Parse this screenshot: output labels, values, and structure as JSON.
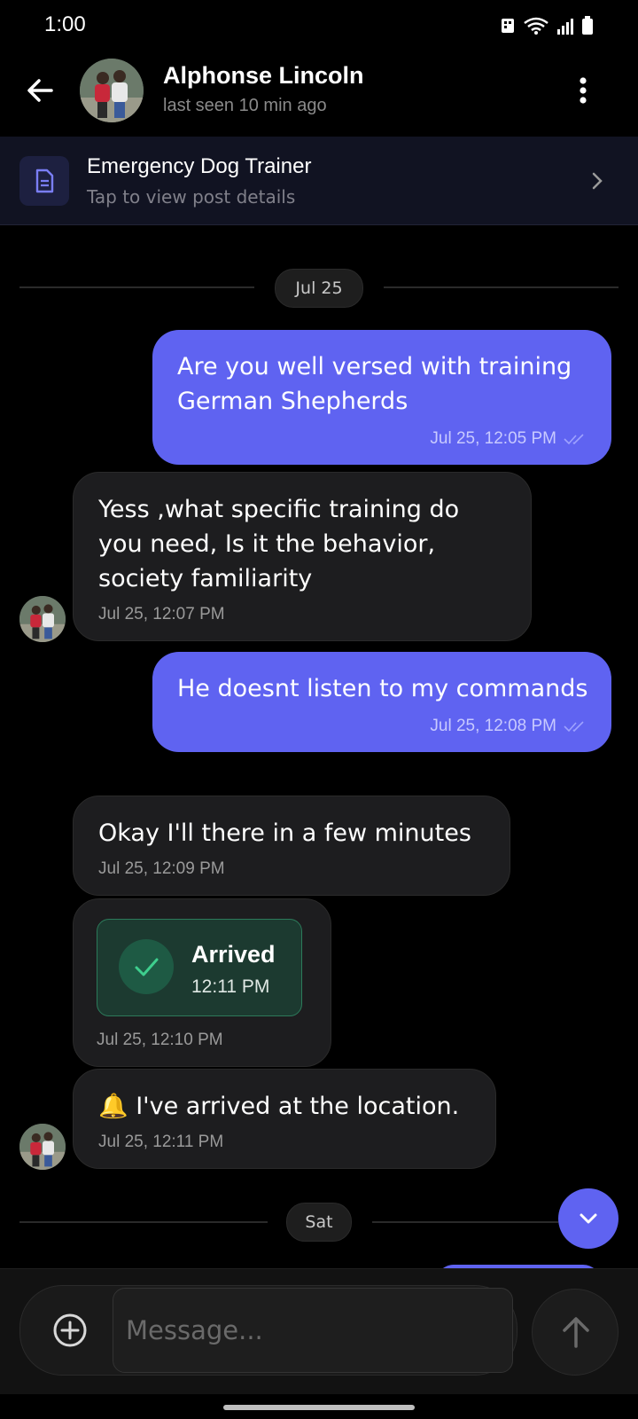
{
  "status": {
    "time": "1:00"
  },
  "header": {
    "name": "Alphonse Lincoln",
    "last_seen": "last seen 10 min ago"
  },
  "post": {
    "title": "Emergency Dog Trainer",
    "subtitle": "Tap to view post details"
  },
  "dates": {
    "first": "Jul 25",
    "second": "Sat"
  },
  "messages": [
    {
      "dir": "out",
      "text": "Are you well versed with training German Shepherds",
      "time": "Jul 25, 12:05 PM"
    },
    {
      "dir": "in",
      "text": "Yess ,what specific training do you need, Is it the behavior, society familiarity",
      "time": "Jul 25, 12:07 PM"
    },
    {
      "dir": "out",
      "text": "He doesnt listen to my commands",
      "time": "Jul 25, 12:08 PM"
    },
    {
      "dir": "in",
      "text": "Okay I'll there in a few minutes",
      "time": "Jul 25, 12:09 PM"
    },
    {
      "dir": "in",
      "type": "arrived",
      "card_title": "Arrived",
      "card_time": "12:11 PM",
      "time": "Jul 25, 12:10 PM"
    },
    {
      "dir": "in",
      "text": "🔔 I've arrived at the location.",
      "time": "Jul 25, 12:11 PM"
    }
  ],
  "composer": {
    "placeholder": "Message..."
  },
  "colors": {
    "accent": "#5f63f1",
    "incoming": "#1d1d1f",
    "success": "#2c7a5a"
  }
}
